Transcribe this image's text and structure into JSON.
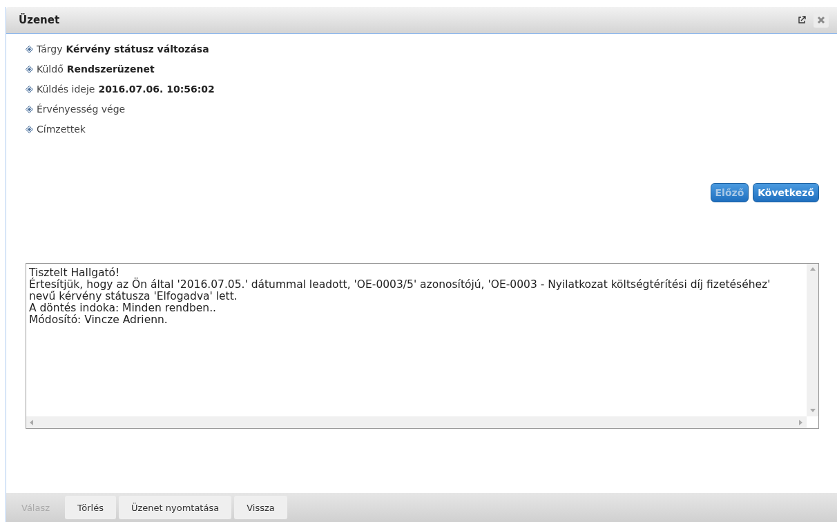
{
  "window": {
    "title": "Üzenet"
  },
  "fields": [
    {
      "label": "Tárgy",
      "value": "Kérvény státusz változása"
    },
    {
      "label": "Küldő",
      "value": "Rendszerüzenet"
    },
    {
      "label": "Küldés ideje",
      "value": "2016.07.06. 10:56:02"
    },
    {
      "label": "Érvényesség vége"
    },
    {
      "label": "Címzettek"
    }
  ],
  "nav_buttons": [
    {
      "label": "Előző",
      "disabled": true
    },
    {
      "label": "Következő",
      "disabled": false
    }
  ],
  "message_lines": [
    "Tisztelt Hallgató!",
    "Értesítjük, hogy az Ön által '2016.07.05.' dátummal leadott, 'OE-0003/5' azonosítójú, 'OE-0003 - Nyilatkozat költségtérítési díj fizetéséhez' nevű kérvény státusza 'Elfogadva' lett.",
    "A döntés indoka: Minden rendben..",
    "Módosító: Vincze Adrienn."
  ],
  "footer_buttons": [
    {
      "label": "Válasz",
      "disabled": true
    },
    {
      "label": "Törlés",
      "disabled": false
    },
    {
      "label": "Üzenet nyomtatása",
      "disabled": false
    },
    {
      "label": "Vissza",
      "disabled": false
    }
  ]
}
